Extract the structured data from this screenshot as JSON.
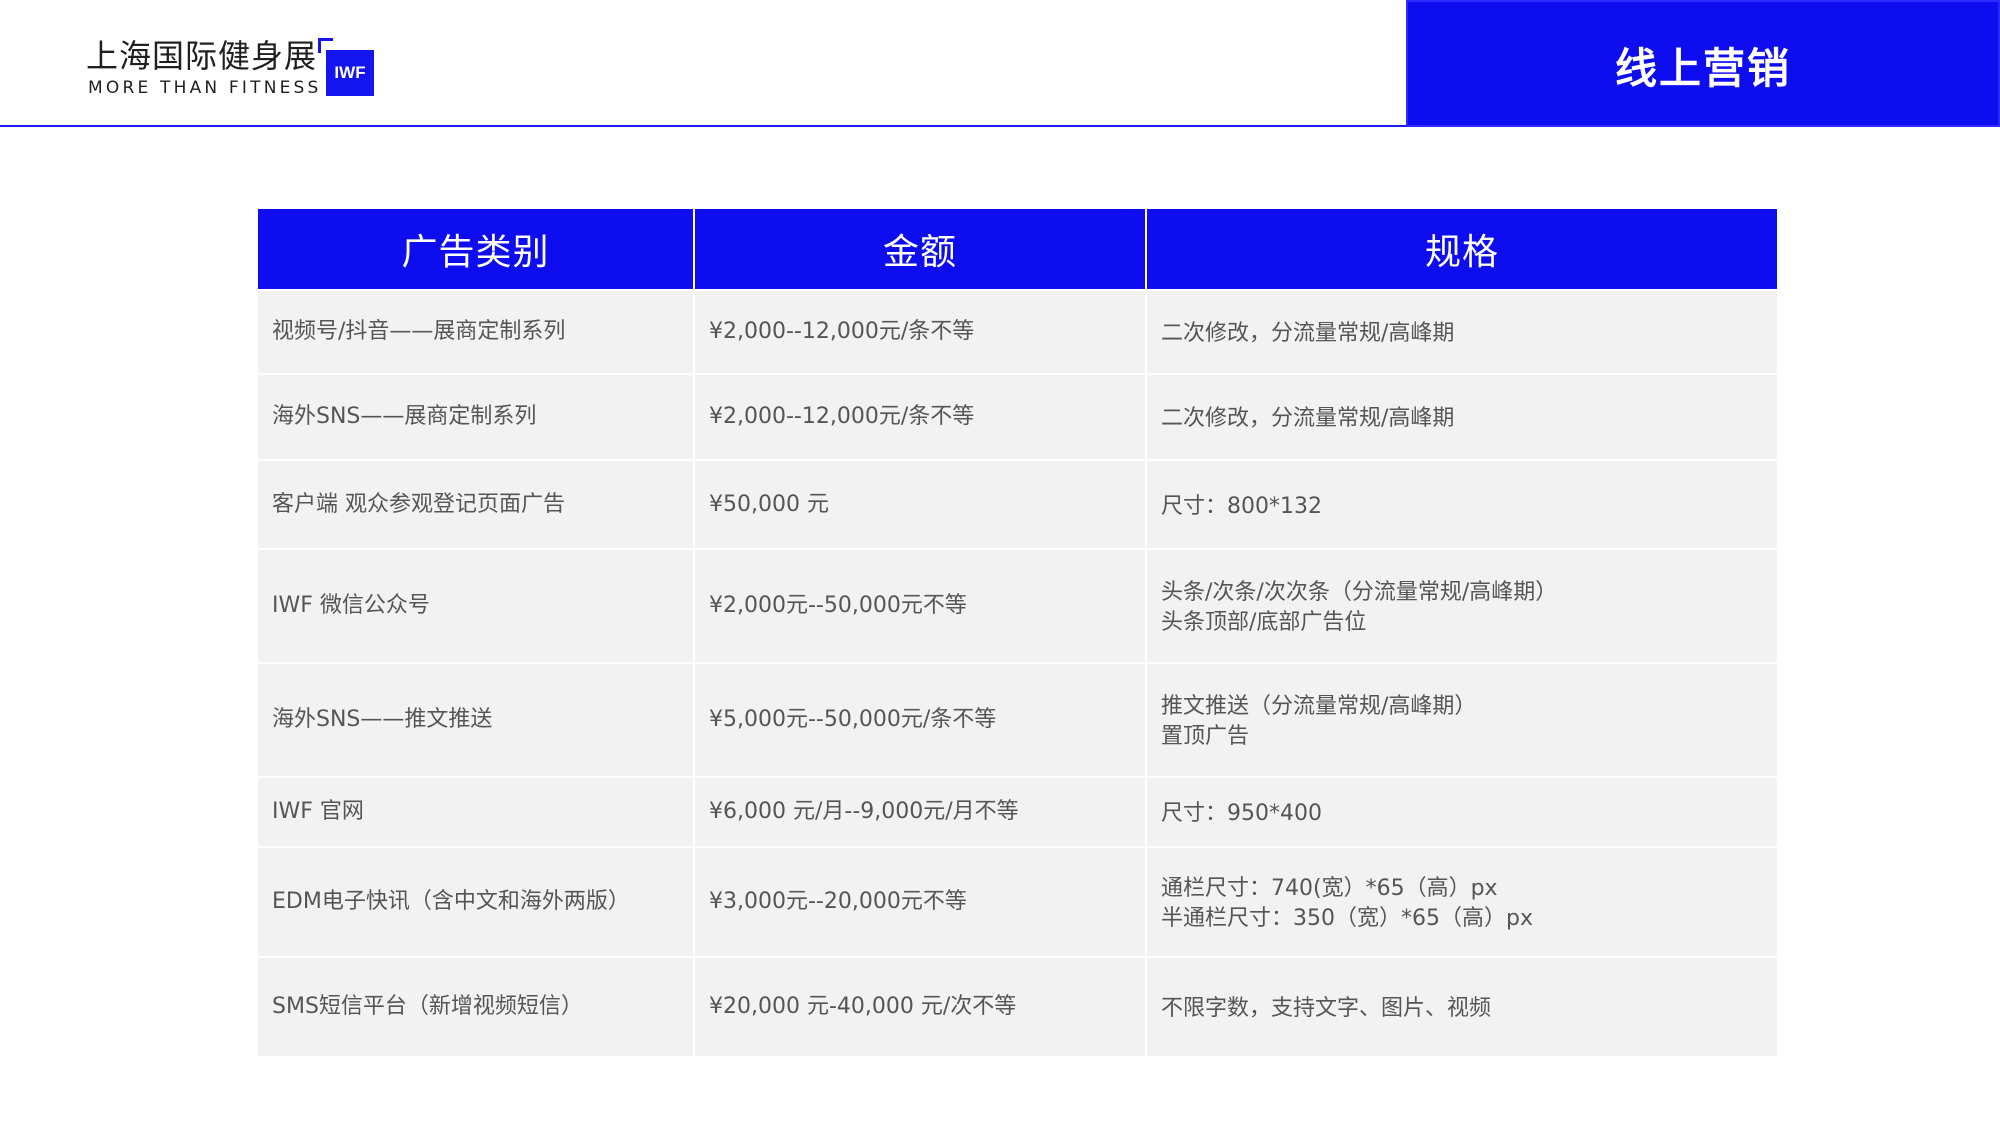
{
  "header": {
    "logo_cn": "上海国际健身展",
    "logo_en": "MORE THAN FITNESS",
    "logo_badge": "IWF",
    "page_title": "线上营销"
  },
  "colors": {
    "brand_blue": "#0d0df0",
    "row_bg": "#f2f2f2",
    "cell_text": "#555555"
  },
  "table": {
    "headers": [
      "广告类别",
      "金额",
      "规格"
    ],
    "rows": [
      {
        "category": "视频号/抖音——展商定制系列",
        "price": "¥2,000--12,000元/条不等",
        "spec": [
          "二次修改，分流量常规/高峰期"
        ]
      },
      {
        "category": "海外SNS——展商定制系列",
        "price": "¥2,000--12,000元/条不等",
        "spec": [
          "二次修改，分流量常规/高峰期"
        ]
      },
      {
        "category": "客户端 观众参观登记页面广告",
        "price": "¥50,000 元",
        "spec": [
          "尺寸：800*132"
        ]
      },
      {
        "category": "IWF 微信公众号",
        "price": "¥2,000元--50,000元不等",
        "spec": [
          "头条/次条/次次条（分流量常规/高峰期）",
          "头条顶部/底部广告位"
        ]
      },
      {
        "category": "海外SNS——推文推送",
        "price": "¥5,000元--50,000元/条不等",
        "spec": [
          "推文推送（分流量常规/高峰期）",
          "置顶广告"
        ]
      },
      {
        "category": "IWF 官网",
        "price": "¥6,000 元/月--9,000元/月不等",
        "spec": [
          "尺寸：950*400"
        ]
      },
      {
        "category": "EDM电子快讯（含中文和海外两版）",
        "price": "¥3,000元--20,000元不等",
        "spec": [
          "通栏尺寸：740(宽）*65（高）px",
          "半通栏尺寸：350（宽）*65（高）px"
        ]
      },
      {
        "category": "SMS短信平台（新增视频短信）",
        "price": "¥20,000 元-40,000 元/次不等",
        "spec": [
          "不限字数，支持文字、图片、视频"
        ]
      }
    ]
  }
}
